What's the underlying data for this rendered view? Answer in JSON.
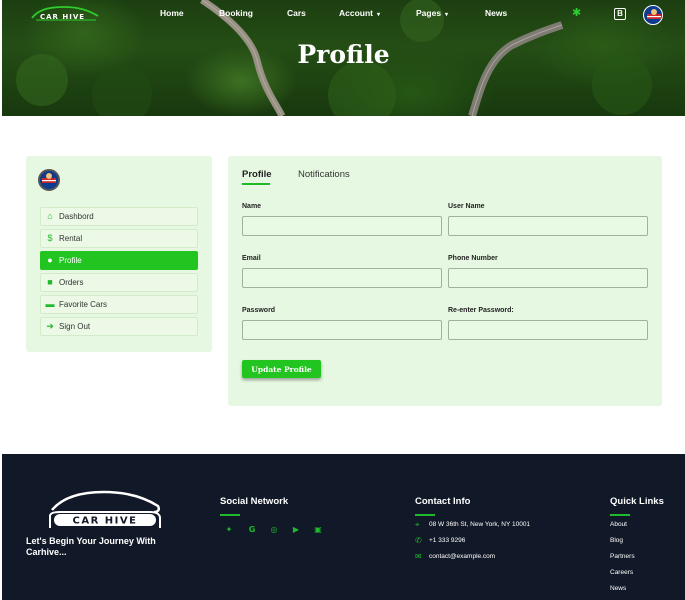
{
  "brand": {
    "name": "CAR HIVE"
  },
  "nav": {
    "items": [
      {
        "label": "Home"
      },
      {
        "label": "Booking"
      },
      {
        "label": "Cars"
      },
      {
        "label": "Account"
      },
      {
        "label": "Pages"
      },
      {
        "label": "News"
      }
    ],
    "toggle_label": "B"
  },
  "hero": {
    "title": "Profile"
  },
  "sidebar": {
    "items": [
      {
        "label": "Dashbord",
        "icon": "home-icon"
      },
      {
        "label": "Rental",
        "icon": "dollar-icon"
      },
      {
        "label": "Profile",
        "icon": "user-icon",
        "active": true
      },
      {
        "label": "Orders",
        "icon": "gift-icon"
      },
      {
        "label": "Favorite Cars",
        "icon": "car-icon"
      },
      {
        "label": "Sign Out",
        "icon": "sign-out-icon"
      }
    ]
  },
  "profile_form": {
    "tabs": [
      {
        "label": "Profile",
        "active": true
      },
      {
        "label": "Notifications"
      }
    ],
    "fields": {
      "name": {
        "label": "Name",
        "value": ""
      },
      "username": {
        "label": "User Name",
        "value": ""
      },
      "email": {
        "label": "Email",
        "value": ""
      },
      "phone": {
        "label": "Phone Number",
        "value": ""
      },
      "password": {
        "label": "Password",
        "value": ""
      },
      "repassword": {
        "label": "Re-enter Password:",
        "value": ""
      }
    },
    "submit_label": "Update Profile"
  },
  "footer": {
    "tagline": "Let's Begin Your Journey With Carhive...",
    "social": {
      "heading": "Social Network",
      "icons": [
        "twitter-icon",
        "google-icon",
        "instagram-icon",
        "youtube-icon",
        "linkedin-icon"
      ]
    },
    "contact": {
      "heading": "Contact Info",
      "address": "08 W 36th St, New York, NY 10001",
      "phone": "+1 333 9296",
      "email": "contact@example.com"
    },
    "quick_links": {
      "heading": "Quick Links",
      "items": [
        "About",
        "Blog",
        "Partners",
        "Careers",
        "News"
      ]
    }
  },
  "colors": {
    "accent": "#22c51f",
    "footer_bg": "#111827",
    "panel_bg": "#e6f8e2"
  }
}
